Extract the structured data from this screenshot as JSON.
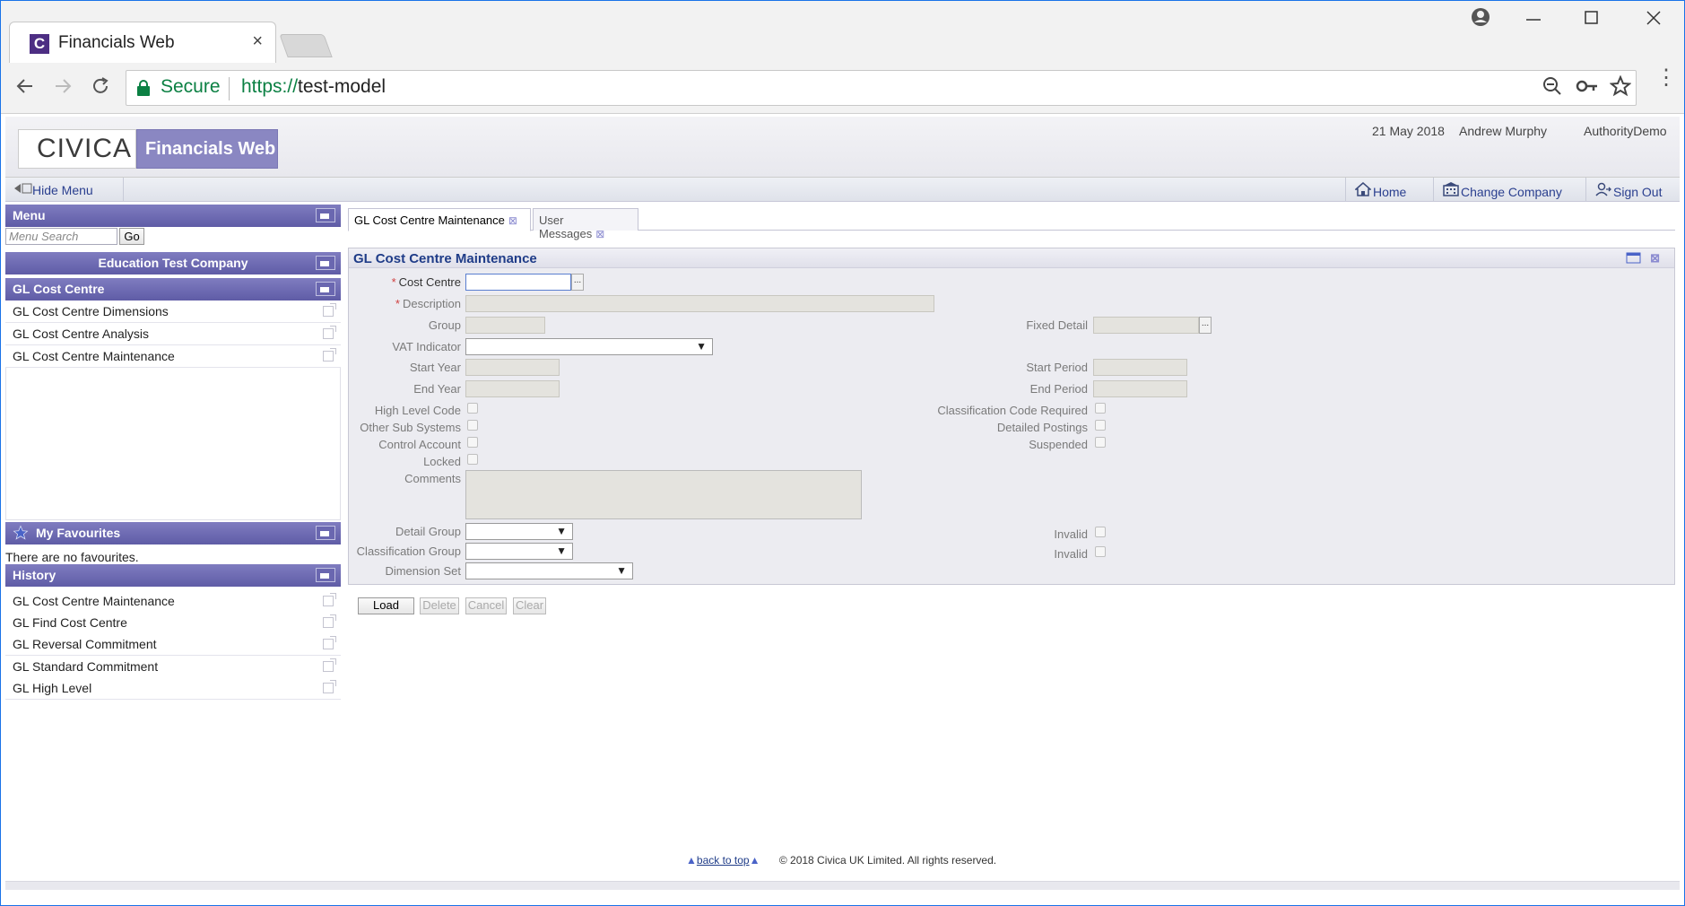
{
  "browser": {
    "tab_title": "Financials Web",
    "tab_close": "×",
    "favicon_letter": "C",
    "secure_label": "Secure",
    "url_scheme": "https://",
    "url_host": "test-model"
  },
  "header": {
    "logo": "CIVICA",
    "product": "Financials Web",
    "date": "21 May 2018",
    "user": "Andrew Murphy",
    "authority": "AuthorityDemo"
  },
  "toolbar": {
    "hide_menu": "Hide Menu",
    "home": "Home",
    "change_company": "Change Company",
    "sign_out": "Sign Out"
  },
  "sidebar": {
    "menu_title": "Menu",
    "search_placeholder": "Menu Search",
    "go_label": "Go",
    "company": "Education Test Company",
    "section": "GL Cost Centre",
    "items": [
      {
        "label": "GL Cost Centre Dimensions"
      },
      {
        "label": "GL Cost Centre Analysis"
      },
      {
        "label": "GL Cost Centre Maintenance"
      }
    ],
    "favourites_title": "My Favourites",
    "favourites_empty": "There are no favourites.",
    "history_title": "History",
    "history": [
      {
        "label": "GL Cost Centre Maintenance"
      },
      {
        "label": "GL Find Cost Centre"
      },
      {
        "label": "GL Reversal Commitment"
      },
      {
        "label": "GL Standard Commitment"
      },
      {
        "label": "GL High Level"
      }
    ]
  },
  "content": {
    "tabs": [
      {
        "label": "GL Cost Centre Maintenance"
      },
      {
        "label": "User Messages"
      }
    ],
    "tab_close": "⊠",
    "form_title": "GL Cost Centre Maintenance",
    "labels": {
      "cost_centre": "Cost Centre",
      "description": "Description",
      "group": "Group",
      "fixed_detail": "Fixed Detail",
      "vat_indicator": "VAT Indicator",
      "start_year": "Start Year",
      "start_period": "Start Period",
      "end_year": "End Year",
      "end_period": "End Period",
      "high_level_code": "High Level Code",
      "classification_code_required": "Classification Code Required",
      "other_sub_systems": "Other Sub Systems",
      "detailed_postings": "Detailed Postings",
      "control_account": "Control Account",
      "suspended": "Suspended",
      "locked": "Locked",
      "comments": "Comments",
      "detail_group": "Detail Group",
      "classification_group": "Classification Group",
      "dimension_set": "Dimension Set",
      "invalid": "Invalid"
    },
    "ellipsis": "...",
    "select_arrow": "▼",
    "buttons": {
      "load": "Load",
      "delete": "Delete",
      "cancel": "Cancel",
      "clear": "Clear"
    }
  },
  "footer": {
    "back_to_top": "back to top",
    "copyright": "© 2018 Civica UK Limited. All rights reserved."
  }
}
